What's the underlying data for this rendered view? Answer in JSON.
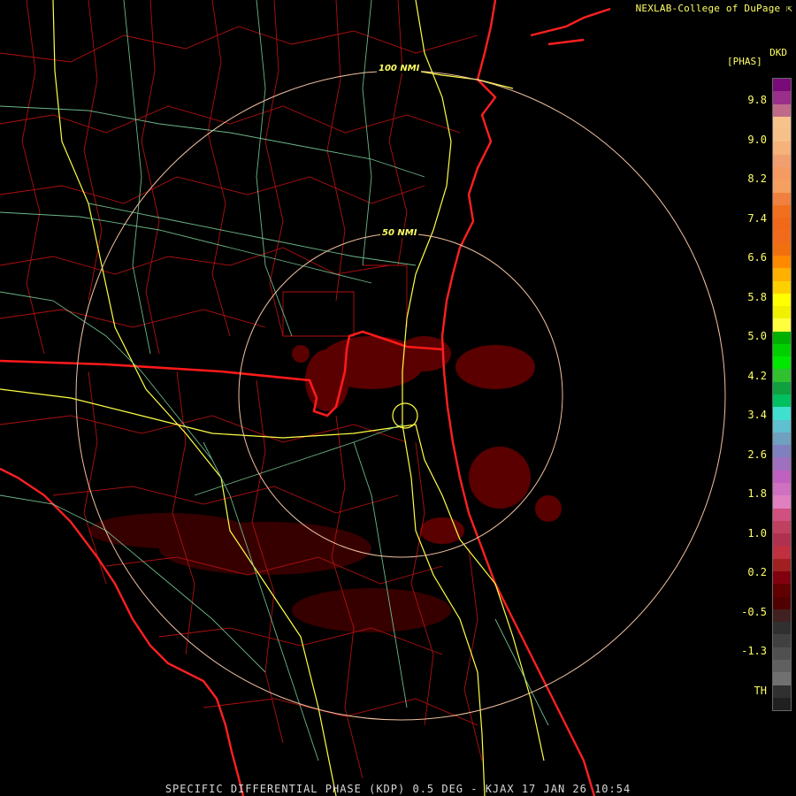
{
  "header": {
    "credit": "NEXLAB-College of DuPage",
    "credit_icon": "external-link-icon",
    "product_code": "DKD",
    "product_unit": "[PHAS]"
  },
  "footer": {
    "caption": "SPECIFIC DIFFERENTIAL PHASE (KDP) 0.5 DEG - KJAX 17 JAN 26 10:54"
  },
  "range_rings": [
    {
      "label": "100 NMI"
    },
    {
      "label": "50 NMI"
    }
  ],
  "color_scale": {
    "tick_labels": [
      "9.8",
      "9.0",
      "8.2",
      "7.4",
      "6.6",
      "5.8",
      "5.0",
      "4.2",
      "3.4",
      "2.6",
      "1.8",
      "1.0",
      "0.2",
      "-0.5",
      "-1.3",
      "TH"
    ],
    "colors": [
      "#7a0a7a",
      "#9a2e8a",
      "#c06a8a",
      "#f7c28c",
      "#f7c08a",
      "#f5b27a",
      "#f0a070",
      "#f59a60",
      "#f5a060",
      "#f08040",
      "#f07020",
      "#f06818",
      "#f26a1c",
      "#f07010",
      "#ff8a00",
      "#ffb000",
      "#ffd000",
      "#ffff00",
      "#f0f000",
      "#ffff40",
      "#00b000",
      "#00d000",
      "#00e800",
      "#30c030",
      "#10a040",
      "#00c060",
      "#40e0d0",
      "#60c0d0",
      "#70a0c0",
      "#8080c0",
      "#a070c0",
      "#c060c0",
      "#d070c0",
      "#e080c0",
      "#d05080",
      "#c04060",
      "#b03050",
      "#c03040",
      "#a02020",
      "#800010",
      "#600000",
      "#500000",
      "#402020",
      "#303030",
      "#404040",
      "#505050",
      "#606060",
      "#707070",
      "#303030",
      "#202020"
    ]
  },
  "map_layers": [
    "county-boundaries",
    "state-boundaries",
    "coastline",
    "highways",
    "range-rings",
    "radar-echoes"
  ]
}
